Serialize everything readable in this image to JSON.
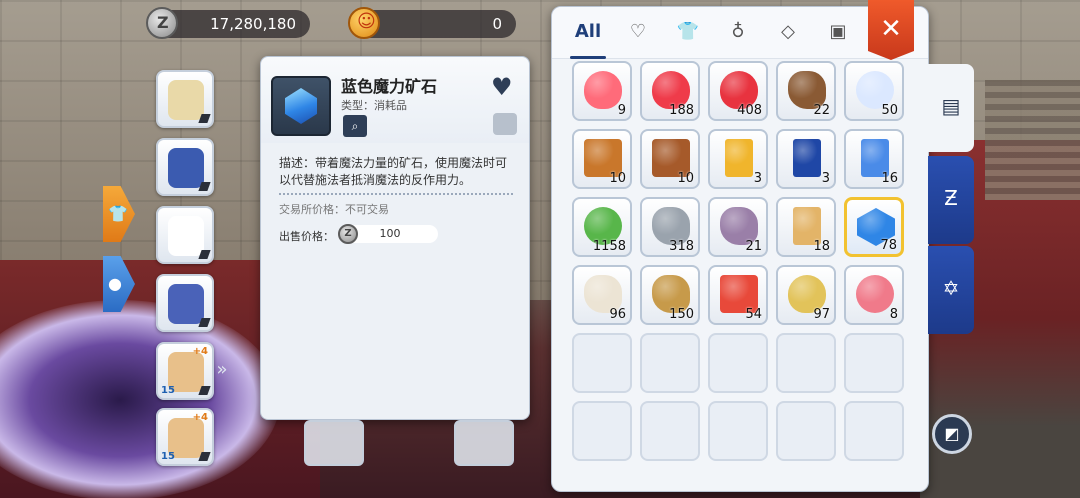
{
  "currency": {
    "zeny": {
      "icon": "zeny-coin-icon",
      "amount": "17,280,180"
    },
    "gem": {
      "icon": "gem-coin-icon",
      "amount": "0"
    }
  },
  "equipment": [
    {
      "name": "headgear",
      "color": "#e9d9a8",
      "level": "",
      "refine": ""
    },
    {
      "name": "armor",
      "color": "#3b5bb0",
      "level": "",
      "refine": ""
    },
    {
      "name": "garment",
      "color": "#ffffff",
      "level": "",
      "refine": ""
    },
    {
      "name": "shoes",
      "color": "#4a62b8",
      "level": "",
      "refine": ""
    },
    {
      "name": "accessory-1",
      "color": "#e8c08a",
      "level": "15",
      "refine": "+4"
    },
    {
      "name": "accessory-2",
      "color": "#e8c08a",
      "level": "15",
      "refine": "+4"
    }
  ],
  "detail": {
    "name": "蓝色魔力矿石",
    "type": "类型：消耗品",
    "description": "描述：带着魔法力量的矿石，使用魔法时可以代替施法者抵消魔法的反作用力。",
    "trade": "交易所价格：不可交易",
    "sell_label": "出售价格：",
    "sell_value": "100"
  },
  "inventory": {
    "tabs": [
      {
        "label": "All",
        "icon": ""
      },
      {
        "label": "",
        "icon": "heart-icon"
      },
      {
        "label": "",
        "icon": "shirt-icon"
      },
      {
        "label": "",
        "icon": "potion-icon"
      },
      {
        "label": "",
        "icon": "diamond-icon"
      },
      {
        "label": "",
        "icon": "card-icon"
      }
    ],
    "active_tab": "All",
    "items": [
      {
        "name": "red-slime-potion",
        "count": "9",
        "color": "#ff6b7a",
        "shape": "potion"
      },
      {
        "name": "red-potion",
        "count": "188",
        "color": "#ef3b4a",
        "shape": "potion"
      },
      {
        "name": "red-flask",
        "count": "408",
        "color": "#e8333f",
        "shape": "potion"
      },
      {
        "name": "wooden-branch",
        "count": "22",
        "color": "#8a5a34",
        "shape": "rock"
      },
      {
        "name": "white-lotus",
        "count": "50",
        "color": "#dbe8ff",
        "shape": "round"
      },
      {
        "name": "bento-box",
        "count": "10",
        "color": "#c9772b",
        "shape": "box"
      },
      {
        "name": "lunch-box",
        "count": "10",
        "color": "#a65a2a",
        "shape": "box"
      },
      {
        "name": "gold-card",
        "count": "3",
        "color": "#f0b52c",
        "shape": "card"
      },
      {
        "name": "blue-shield-card",
        "count": "3",
        "color": "#1f47a6",
        "shape": "card"
      },
      {
        "name": "blue-scroll",
        "count": "16",
        "color": "#4a8be8",
        "shape": "card"
      },
      {
        "name": "green-orb",
        "count": "1158",
        "color": "#58b64a",
        "shape": "round"
      },
      {
        "name": "grey-rock",
        "count": "318",
        "color": "#9aa3ad",
        "shape": "rock"
      },
      {
        "name": "purple-stone",
        "count": "21",
        "color": "#9a7fa8",
        "shape": "rock"
      },
      {
        "name": "old-ticket",
        "count": "18",
        "color": "#e3b468",
        "shape": "card"
      },
      {
        "name": "blue-magic-ore",
        "count": "78",
        "color": "#2f86e6",
        "shape": "gem",
        "selected": true
      },
      {
        "name": "animal-skull",
        "count": "96",
        "color": "#ece4d4",
        "shape": "rock"
      },
      {
        "name": "gold-pile",
        "count": "150",
        "color": "#c79a4a",
        "shape": "rock"
      },
      {
        "name": "red-gem-box",
        "count": "54",
        "color": "#e8493a",
        "shape": "box"
      },
      {
        "name": "golden-chalice",
        "count": "97",
        "color": "#e2c35a",
        "shape": "potion"
      },
      {
        "name": "rose-crystal",
        "count": "8",
        "color": "#f07a8a",
        "shape": "round"
      }
    ],
    "empty_cells": 10
  },
  "side_tabs": [
    {
      "name": "bag-tab",
      "icon": "backpack-icon",
      "active": true
    },
    {
      "name": "zeny-bag-tab",
      "icon": "money-bag-icon",
      "active": false
    },
    {
      "name": "card-album-tab",
      "icon": "hexagram-icon",
      "active": false
    }
  ],
  "colors": {
    "accent": "#1f3f7a",
    "close": "#e04a24",
    "selected": "#f2c230"
  }
}
